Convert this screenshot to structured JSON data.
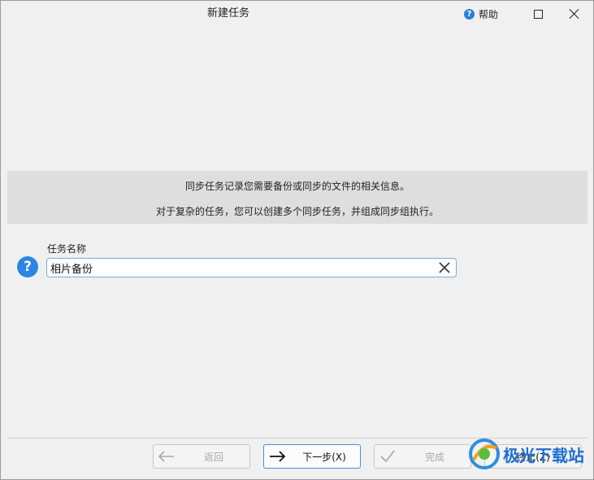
{
  "window": {
    "title": "新建任务",
    "help_label": "帮助",
    "help_icon": "question-circle-icon",
    "maximize_icon": "maximize-icon",
    "close_icon": "close-icon"
  },
  "info": {
    "line1": "同步任务记录您需要备份或同步的文件的相关信息。",
    "line2": "对于复杂的任务，您可以创建多个同步任务，并组成同步组执行。"
  },
  "form": {
    "task_name_label": "任务名称",
    "task_name_value": "相片备份",
    "help_icon": "question-circle-icon",
    "clear_icon": "clear-x-icon"
  },
  "footer": {
    "back_label": "返回",
    "next_label": "下一步(X)",
    "finish_label": "完成",
    "abort_label": "终止(Z)"
  },
  "watermark": {
    "text": "极光下载站"
  },
  "colors": {
    "accent": "#2a86e2",
    "input_border": "#7fa8d8",
    "banner_bg": "#dedede",
    "window_bg": "#f0f0f0"
  }
}
